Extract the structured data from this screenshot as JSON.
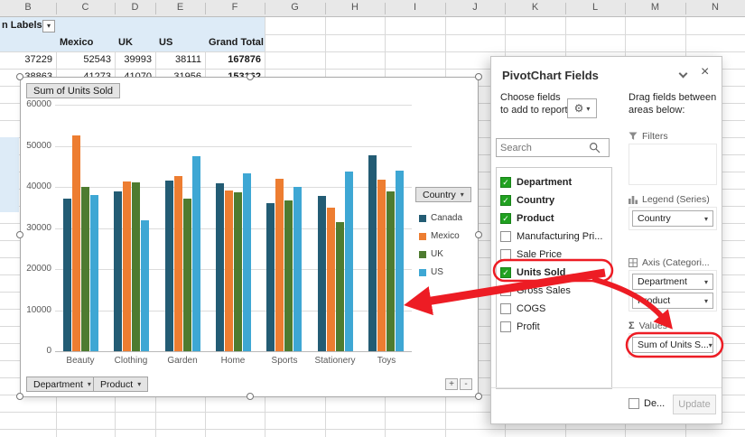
{
  "colors": {
    "annotation_red": "#ED1C24",
    "checkbox_green": "#21A121",
    "pivot_header_fill": "#DDEBF7"
  },
  "spreadsheet": {
    "column_letters": [
      "B",
      "C",
      "D",
      "E",
      "F",
      "G",
      "H",
      "I",
      "J",
      "K",
      "L",
      "M",
      "N"
    ],
    "pivot": {
      "labels_cell": "n Labels",
      "col_headers": [
        "Mexico",
        "UK",
        "US",
        "Grand Total"
      ],
      "row1": [
        "37229",
        "52543",
        "39993",
        "38111",
        "167876"
      ],
      "row2": [
        "38863",
        "41273",
        "41070",
        "31956",
        "153162"
      ]
    }
  },
  "chart": {
    "value_field_button": "Sum of Units Sold",
    "legend_button": "Country",
    "axis_buttons": [
      "Department",
      "Product"
    ],
    "expand_plus": "+",
    "expand_minus": "-"
  },
  "chart_data": {
    "type": "bar",
    "title": "Sum of Units Sold",
    "categories": [
      "Beauty",
      "Clothing",
      "Garden",
      "Home",
      "Sports",
      "Stationery",
      "Toys"
    ],
    "series": [
      {
        "name": "Canada",
        "color": "#235C74",
        "values": [
          37229,
          38863,
          41450,
          40950,
          36000,
          37750,
          47800
        ]
      },
      {
        "name": "Mexico",
        "color": "#ED7D31",
        "values": [
          52543,
          41273,
          42600,
          39050,
          41950,
          35000,
          41800
        ]
      },
      {
        "name": "UK",
        "color": "#4E7B30",
        "values": [
          39993,
          41070,
          37200,
          38600,
          36650,
          31500,
          38800
        ]
      },
      {
        "name": "US",
        "color": "#3EA7D4",
        "values": [
          38111,
          31956,
          47450,
          43250,
          40050,
          43750,
          44000
        ]
      }
    ],
    "ylim": [
      0,
      60000
    ],
    "ytick_step": 10000,
    "grid": true,
    "legend_position": "right",
    "legend_title": "Country"
  },
  "panel": {
    "title": "PivotChart Fields",
    "choose_text": "Choose fields to add to report:",
    "search_placeholder": "Search",
    "fields": [
      {
        "label": "Department",
        "checked": true
      },
      {
        "label": "Country",
        "checked": true
      },
      {
        "label": "Product",
        "checked": true
      },
      {
        "label": "Manufacturing Pri...",
        "checked": false
      },
      {
        "label": "Sale Price",
        "checked": false
      },
      {
        "label": "Units Sold",
        "checked": true,
        "highlight": true
      },
      {
        "label": "Gross Sales",
        "checked": false
      },
      {
        "label": "COGS",
        "checked": false
      },
      {
        "label": "Profit",
        "checked": false
      }
    ],
    "drag_text": "Drag fields between areas below:",
    "areas": {
      "filters": {
        "label": "Filters",
        "items": []
      },
      "legend": {
        "label": "Legend (Series)",
        "items": [
          "Country"
        ]
      },
      "axis": {
        "label": "Axis (Categori...",
        "items": [
          "Department",
          "Product"
        ]
      },
      "values": {
        "label": "Values",
        "items": [
          "Sum of Units S..."
        ]
      }
    },
    "defer_label": "De...",
    "update_label": "Update"
  }
}
